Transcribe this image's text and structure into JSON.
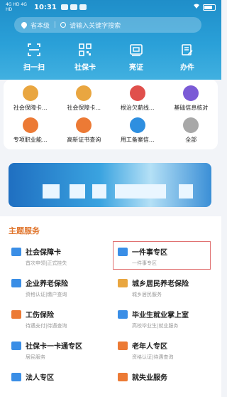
{
  "status_bar": {
    "time": "10:31",
    "signal_text": "4G HD 4G HD"
  },
  "search": {
    "region": "省本级",
    "placeholder": "请输入关键字搜索"
  },
  "quick_actions": [
    {
      "label": "扫一扫",
      "icon": "scan-icon"
    },
    {
      "label": "社保卡",
      "icon": "qr-code-icon"
    },
    {
      "label": "亮证",
      "icon": "id-card-icon"
    },
    {
      "label": "办件",
      "icon": "edit-document-icon"
    }
  ],
  "services_grid": [
    {
      "label": "社会保障卡...",
      "color": "#e9a640"
    },
    {
      "label": "社会保障卡...",
      "color": "#e9a640"
    },
    {
      "label": "根治欠薪线...",
      "color": "#e0504c"
    },
    {
      "label": "基础信息核对",
      "color": "#7b5bd6"
    },
    {
      "label": "专项职业能...",
      "color": "#ec7a35"
    },
    {
      "label": "高新证书查询",
      "color": "#ec7a35"
    },
    {
      "label": "用工备案信...",
      "color": "#2e8fe0"
    },
    {
      "label": "全部",
      "color": "#a8a8a8"
    }
  ],
  "section": {
    "title": "主题服务",
    "items": [
      {
        "title": "社会保障卡",
        "subtitle": "首次申领|正式挂失",
        "color": "#3a8ee6"
      },
      {
        "title": "一件事专区",
        "subtitle": "一件事专区",
        "color": "#3a8ee6"
      },
      {
        "title": "企业养老保险",
        "subtitle": "资格认证|缴户查询",
        "color": "#3a8ee6"
      },
      {
        "title": "城乡居民养老保险",
        "subtitle": "城乡居民服务",
        "color": "#e9a640"
      },
      {
        "title": "工伤保险",
        "subtitle": "待遇支付|待遇查询",
        "color": "#ec7a35"
      },
      {
        "title": "毕业生就业掌上室",
        "subtitle": "高校毕业生|就业服务",
        "color": "#3a8ee6"
      },
      {
        "title": "社保卡一卡通专区",
        "subtitle": "居民服务",
        "color": "#3a8ee6"
      },
      {
        "title": "老年人专区",
        "subtitle": "资格认证|待遇查询",
        "color": "#ec7a35"
      },
      {
        "title": "法人专区",
        "subtitle": "",
        "color": "#3a8ee6"
      },
      {
        "title": "就失业服务",
        "subtitle": "",
        "color": "#ec7a35"
      }
    ]
  }
}
